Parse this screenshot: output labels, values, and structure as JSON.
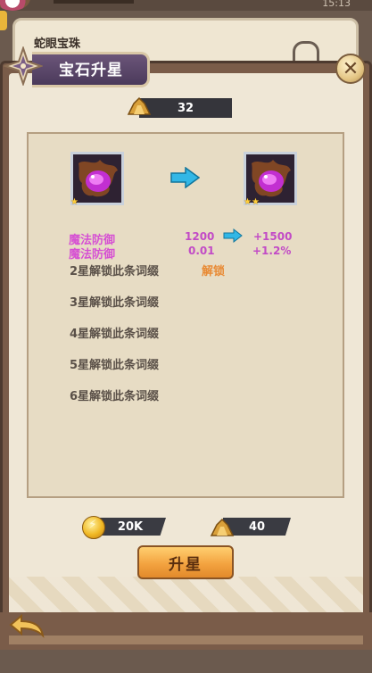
{
  "status_bar": {
    "clock": "15:13"
  },
  "background_card": {
    "title": "蛇眼宝珠"
  },
  "header": {
    "title": "宝石升星",
    "close_icon": "close-icon"
  },
  "currency": {
    "stone_count": "32"
  },
  "gem": {
    "left_stars": 1,
    "right_stars": 2,
    "left_star_text": "★",
    "right_star_text": "★★"
  },
  "stats": [
    {
      "name": "魔法防御",
      "current": "1200",
      "next": "+1500"
    },
    {
      "name": "魔法防御",
      "current": "0.01",
      "next": "+1.2%"
    }
  ],
  "unlock_rows": [
    {
      "label": "2星解锁此条词缀",
      "status": "解锁"
    },
    {
      "label": "3星解锁此条词缀"
    },
    {
      "label": "4星解锁此条词缀"
    },
    {
      "label": "5星解锁此条词缀"
    },
    {
      "label": "6星解锁此条词缀"
    }
  ],
  "cost": {
    "gold": "20K",
    "stone": "40"
  },
  "actions": {
    "upgrade_label": "升星"
  },
  "colors": {
    "accent": "#d651d3",
    "unlock": "#e88a34",
    "button": "#f3a340",
    "ribbon": "#4b3a5b"
  }
}
